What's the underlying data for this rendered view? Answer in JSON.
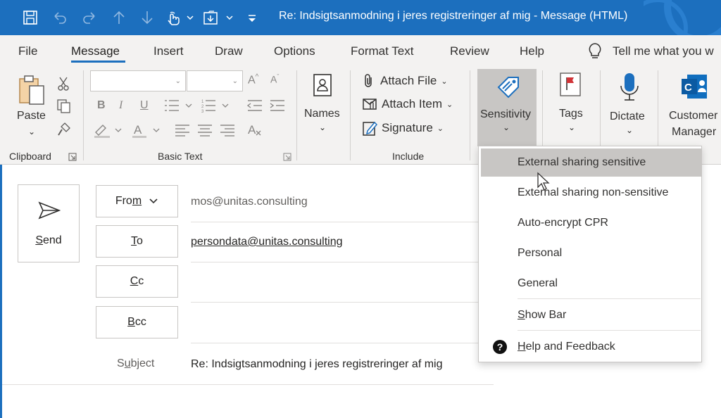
{
  "window": {
    "title": "Re: Indsigtsanmodning i jeres registreringer af mig  -  Message (HTML)",
    "accent": "#1c6fbe"
  },
  "quick_access": [
    "save-icon",
    "undo-icon",
    "redo-icon",
    "up-arrow-icon",
    "down-arrow-icon",
    "touch-mode-icon",
    "move-to-folder-icon",
    "customize-icon"
  ],
  "menu": {
    "tabs": [
      "File",
      "Message",
      "Insert",
      "Draw",
      "Options",
      "Format Text",
      "Review",
      "Help"
    ],
    "active_tab": "Message",
    "tell_me": "Tell me what you w"
  },
  "ribbon": {
    "clipboard": {
      "paste": "Paste",
      "group_label": "Clipboard"
    },
    "basic_text": {
      "group_label": "Basic Text",
      "font_name": "",
      "font_size": ""
    },
    "names": {
      "label": "Names"
    },
    "include": {
      "attach_file": "Attach File",
      "attach_item": "Attach Item",
      "signature": "Signature",
      "group_label": "Include"
    },
    "sensitivity": {
      "label": "Sensitivity"
    },
    "tags": {
      "label": "Tags"
    },
    "dictate": {
      "label": "Dictate"
    },
    "customer_manager": {
      "line1": "Customer",
      "line2": "Manager"
    }
  },
  "compose": {
    "send": {
      "pre": "",
      "key": "S",
      "post": "end"
    },
    "from": {
      "pre": "Fro",
      "key": "m",
      "post": "",
      "value": "mos@unitas.consulting"
    },
    "to": {
      "key": "T",
      "post": "o",
      "value": "persondata@unitas.consulting"
    },
    "cc": {
      "key": "C",
      "post": "c",
      "value": ""
    },
    "bcc": {
      "key": "B",
      "post": "cc",
      "value": ""
    },
    "subject": {
      "pre": "S",
      "key": "u",
      "post": "bject",
      "value": "Re: Indsigtsanmodning i jeres registreringer af mig"
    }
  },
  "sensitivity_menu": {
    "items": [
      "External sharing sensitive",
      "External sharing non-sensitive",
      "Auto-encrypt CPR",
      "Personal",
      "General"
    ],
    "highlighted_index": 0,
    "show_bar": {
      "key": "S",
      "post": "how Bar"
    },
    "help": {
      "key": "H",
      "post": "elp and Feedback"
    }
  }
}
